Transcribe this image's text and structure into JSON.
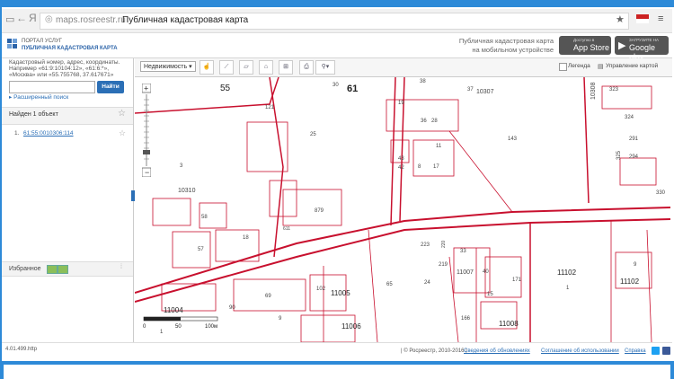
{
  "browser": {
    "back": "←",
    "ya_logo": "Я",
    "url_domain": "maps.rosreestr.ru",
    "page_name": "Публичная кадастровая карта",
    "star": "★"
  },
  "header": {
    "portal_line1": "ПОРТАЛ УСЛУГ",
    "portal_line2": "ПУБЛИЧНАЯ КАДАСТРОВАЯ КАРТА",
    "mobile_line1": "Публичная кадастровая карта",
    "mobile_line2": "на мобильном устройстве",
    "appstore_small": "Доступно в",
    "appstore_big": "App Store",
    "gplay_small": "ЗАГРУЗИТЕ НА",
    "gplay_big": "Google play"
  },
  "search": {
    "hint1": "Кадастровый номер, адрес, координаты.",
    "hint2": "Например «61:9:10104:12», «61:6:*»,",
    "hint3": "«Москва» или «55.755768, 37.617671»",
    "input_value": "",
    "button": "Найти",
    "advanced": "▸ Расширенный поиск"
  },
  "results": {
    "found_text": "Найден 1 объект",
    "item_number": "1.",
    "item_link": "61:55:0010306:114"
  },
  "favorites": {
    "label": "Избранное"
  },
  "toolbar": {
    "layer_select": "Недвижимость",
    "legend": "Легенда",
    "map_control": "Управление картой"
  },
  "map": {
    "scale_0": "0",
    "scale_50": "50",
    "scale_100": "100м"
  },
  "status": {
    "version": "4.01.499.http",
    "copyright": "| © Росреестр, 2010-2016 |",
    "updates": "Сведения об обновлениях",
    "terms": "Соглашение об использовании",
    "help": "Справка"
  },
  "colors": {
    "frame_blue": "#2d8ad8",
    "parcel_red": "#c8102e",
    "button_blue": "#2b6fb6"
  }
}
